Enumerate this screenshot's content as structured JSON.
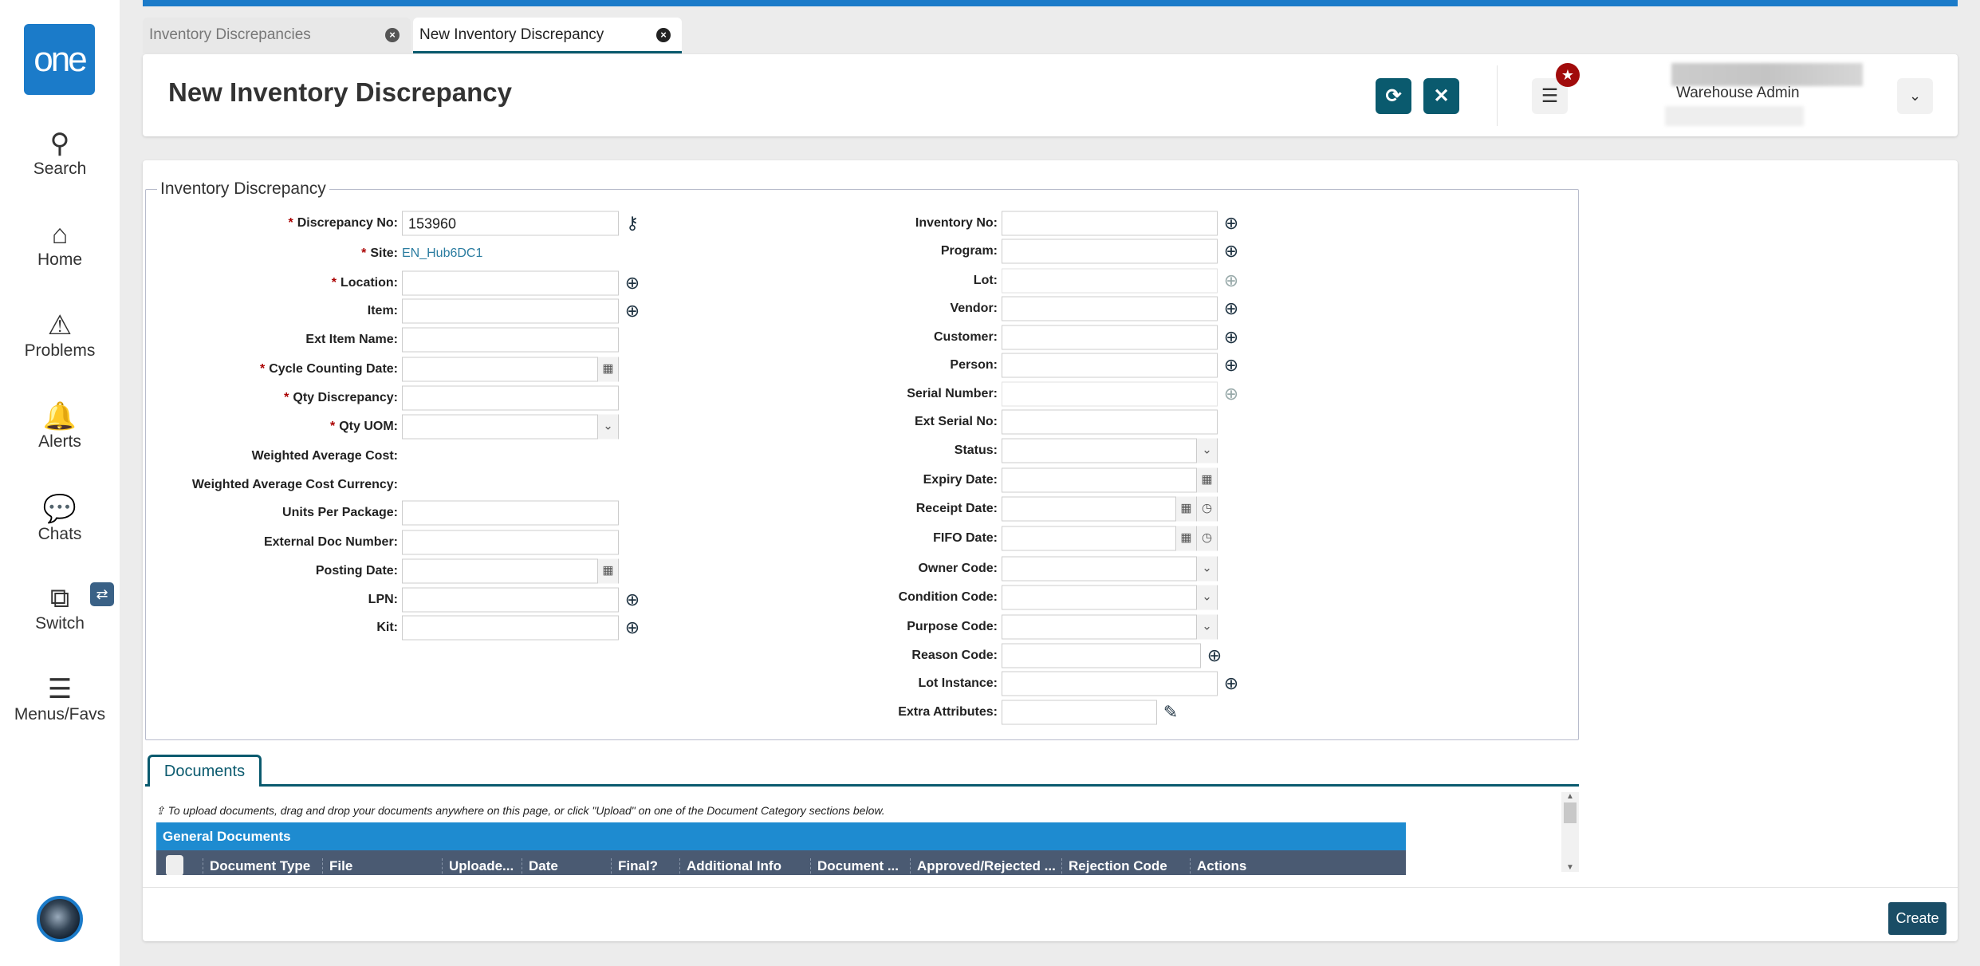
{
  "sidebar": {
    "logo": "one",
    "items": [
      {
        "label": "Search",
        "icon": "search-icon",
        "glyph": "⚲"
      },
      {
        "label": "Home",
        "icon": "home-icon",
        "glyph": "⌂"
      },
      {
        "label": "Problems",
        "icon": "warning-icon",
        "glyph": "⚠"
      },
      {
        "label": "Alerts",
        "icon": "bell-icon",
        "glyph": "🔔"
      },
      {
        "label": "Chats",
        "icon": "chat-icon",
        "glyph": "💬"
      },
      {
        "label": "Switch",
        "icon": "switch-windows-icon",
        "glyph": "⧉"
      },
      {
        "label": "Menus/Favs",
        "icon": "menu-icon",
        "glyph": "☰"
      }
    ]
  },
  "tabs": [
    {
      "label": "Inventory Discrepancies",
      "active": false
    },
    {
      "label": "New Inventory Discrepancy",
      "active": true
    }
  ],
  "header": {
    "title": "New Inventory Discrepancy",
    "user_role": "Warehouse Admin"
  },
  "form": {
    "legend": "Inventory Discrepancy",
    "left": [
      {
        "label": "Discrepancy No:",
        "required": true,
        "type": "text",
        "value": "153960",
        "icon": "key-icon"
      },
      {
        "label": "Site:",
        "required": true,
        "type": "static",
        "value": "EN_Hub6DC1"
      },
      {
        "label": "Location:",
        "required": true,
        "type": "text",
        "icon": "lookup-icon"
      },
      {
        "label": "Item:",
        "type": "text",
        "icon": "lookup-icon"
      },
      {
        "label": "Ext Item Name:",
        "type": "text"
      },
      {
        "label": "Cycle Counting Date:",
        "required": true,
        "type": "date"
      },
      {
        "label": "Qty Discrepancy:",
        "required": true,
        "type": "text"
      },
      {
        "label": "Qty UOM:",
        "required": true,
        "type": "select"
      },
      {
        "label": "Weighted Average Cost:",
        "type": "none"
      },
      {
        "label": "Weighted Average Cost Currency:",
        "type": "none"
      },
      {
        "label": "Units Per Package:",
        "type": "text"
      },
      {
        "label": "External Doc Number:",
        "type": "text"
      },
      {
        "label": "Posting Date:",
        "type": "date"
      },
      {
        "label": "LPN:",
        "type": "text",
        "icon": "lookup-icon"
      },
      {
        "label": "Kit:",
        "type": "text",
        "icon": "lookup-icon"
      }
    ],
    "right": [
      {
        "label": "Inventory No:",
        "type": "text",
        "icon": "lookup-icon"
      },
      {
        "label": "Program:",
        "type": "text",
        "icon": "lookup-icon"
      },
      {
        "label": "Lot:",
        "type": "text",
        "icon": "lookup-icon",
        "disabled": true
      },
      {
        "label": "Vendor:",
        "type": "text",
        "icon": "lookup-icon"
      },
      {
        "label": "Customer:",
        "type": "text",
        "icon": "lookup-icon"
      },
      {
        "label": "Person:",
        "type": "text",
        "icon": "lookup-icon"
      },
      {
        "label": "Serial Number:",
        "type": "text",
        "icon": "lookup-icon",
        "disabled": true
      },
      {
        "label": "Ext Serial No:",
        "type": "text"
      },
      {
        "label": "Status:",
        "type": "select"
      },
      {
        "label": "Expiry Date:",
        "type": "date"
      },
      {
        "label": "Receipt Date:",
        "type": "datetime"
      },
      {
        "label": "FIFO Date:",
        "type": "datetime"
      },
      {
        "label": "Owner Code:",
        "type": "select"
      },
      {
        "label": "Condition Code:",
        "type": "select"
      },
      {
        "label": "Purpose Code:",
        "type": "select"
      },
      {
        "label": "Reason Code:",
        "type": "text",
        "icon": "lookup-icon",
        "short": true
      },
      {
        "label": "Lot Instance:",
        "type": "text",
        "icon": "lookup-icon"
      },
      {
        "label": "Extra Attributes:",
        "type": "text",
        "icon": "edit-icon",
        "shorter": true
      }
    ]
  },
  "documents": {
    "tab": "Documents",
    "hint": "To upload documents, drag and drop your documents anywhere on this page, or click \"Upload\" on one of the Document Category sections below.",
    "section": "General Documents",
    "columns": [
      "Document Type",
      "File",
      "Uploade...",
      "Date",
      "Final?",
      "Additional Info",
      "Document ...",
      "Approved/Rejected ...",
      "Rejection Code",
      "Actions"
    ]
  },
  "footer": {
    "create_label": "Create"
  },
  "colors": {
    "brand": "#1b7bc9",
    "primary_button": "#0a5a6e",
    "section_bar": "#1e8bd0",
    "table_header": "#4a5a72",
    "badge": "#a10b0b"
  }
}
